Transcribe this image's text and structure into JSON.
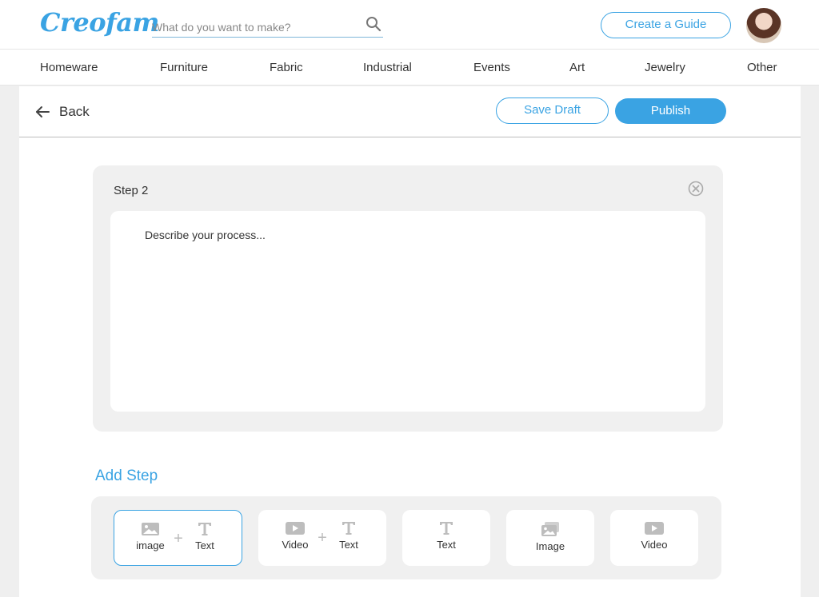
{
  "header": {
    "logo": "Creofam",
    "search_placeholder": "What do you want to make?",
    "create_label": "Create a Guide"
  },
  "categories": [
    "Homeware",
    "Furniture",
    "Fabric",
    "Industrial",
    "Events",
    "Art",
    "Jewelry",
    "Other"
  ],
  "toolbar": {
    "back_label": "Back",
    "save_draft_label": "Save Draft",
    "publish_label": "Publish"
  },
  "step": {
    "title": "Step 2",
    "placeholder": "Describe your process..."
  },
  "add_step": {
    "label": "Add Step",
    "options": {
      "image_text": {
        "image": "image",
        "text": "Text"
      },
      "video_text": {
        "video": "Video",
        "text": "Text"
      },
      "text": "Text",
      "image": "Image",
      "video": "Video"
    },
    "plus": "+"
  },
  "colors": {
    "accent": "#3aa3e3",
    "card": "#f0f0f0",
    "page": "#efefef"
  }
}
